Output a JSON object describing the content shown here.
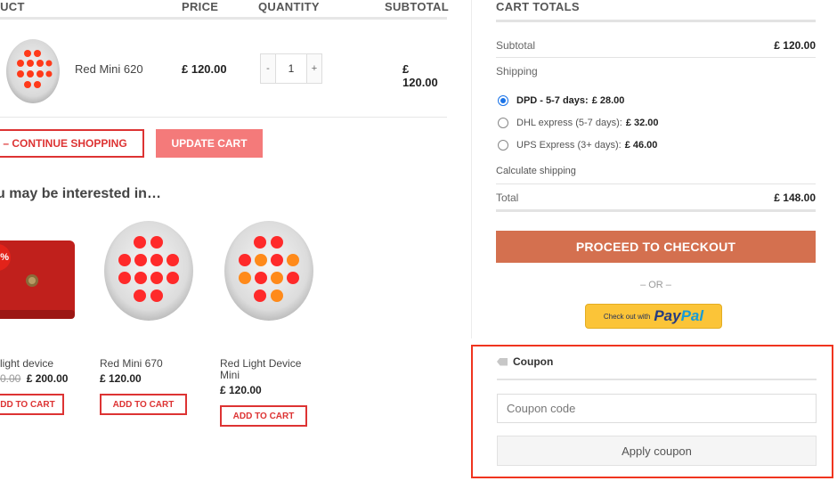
{
  "cart": {
    "headers": {
      "product": "ODUCT",
      "price": "PRICE",
      "quantity": "QUANTITY",
      "subtotal": "SUBTOTAL"
    },
    "items": [
      {
        "name": "Red Mini 620",
        "price": "£ 120.00",
        "qty": "1",
        "qty_minus": "-",
        "qty_plus": "+",
        "subtotal": "£ 120.00"
      }
    ],
    "continue_label": "– CONTINUE SHOPPING",
    "update_label": "UPDATE CART"
  },
  "related": {
    "heading": "u may be interested in…",
    "products": [
      {
        "name": "light device",
        "old_price": "0.00",
        "price": "£ 200.00",
        "button": "DD TO CART",
        "badge": "%"
      },
      {
        "name": "Red Mini 670",
        "price": "£ 120.00",
        "button": "ADD TO CART"
      },
      {
        "name": "Red Light Device Mini",
        "price": "£ 120.00",
        "button": "ADD TO CART"
      }
    ]
  },
  "totals": {
    "title": "CART TOTALS",
    "subtotal_label": "Subtotal",
    "subtotal_value": "£ 120.00",
    "shipping_label": "Shipping",
    "shipping_options": [
      {
        "label": "DPD - 5-7 days:",
        "price": "£ 28.00",
        "selected": true
      },
      {
        "label": "DHL express (5-7 days):",
        "price": "£ 32.00",
        "selected": false
      },
      {
        "label": "UPS Express (3+ days):",
        "price": "£ 46.00",
        "selected": false
      }
    ],
    "calculate_shipping": "Calculate shipping",
    "total_label": "Total",
    "total_value": "£ 148.00",
    "checkout_label": "PROCEED TO CHECKOUT",
    "or_label": "– OR –",
    "paypal_small": "Check out with",
    "paypal_brand_a": "Pay",
    "paypal_brand_b": "Pal"
  },
  "coupon": {
    "title": "Coupon",
    "placeholder": "Coupon code",
    "apply_label": "Apply coupon"
  },
  "colors": {
    "accent_red": "#dd3333",
    "update_button": "#f47a7a",
    "checkout_button": "#d4704f",
    "highlight_border": "#f0341f",
    "paypal_yellow": "#fbc438"
  }
}
